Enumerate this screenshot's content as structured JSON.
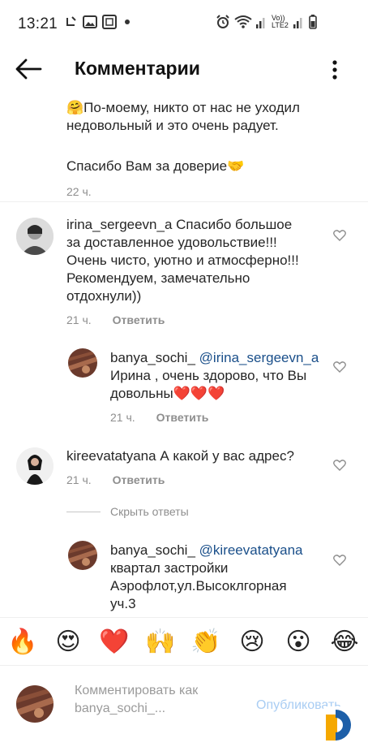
{
  "status_bar": {
    "time": "13:21",
    "network_label": "Vo)) LTE2"
  },
  "header": {
    "title": "Комментарии"
  },
  "comments": [
    {
      "lines": [
        "🤗По-моему, никто от нас не уходил",
        "недовольный и это очень радует.",
        "",
        "Спасибо Вам за доверие🤝"
      ],
      "time": "22 ч."
    },
    {
      "username": "irina_sergeevn_a",
      "first_line": "Спасибо большое",
      "lines": [
        "за доставленное удовольствие!!!",
        "Очень чисто, уютно  и атмосферно!!!",
        "Рекомендуем, замечательно",
        "отдохнули))"
      ],
      "time": "21 ч.",
      "reply_label": "Ответить"
    },
    {
      "username": "banya_sochi_",
      "mention": "@irina_sergeevn_a",
      "lines": [
        "Ирина , очень здорово, что Вы",
        "довольны❤️❤️❤️"
      ],
      "time": "21 ч.",
      "reply_label": "Ответить"
    },
    {
      "username": "kireevatatyana",
      "first_line": "А какой у вас адрес?",
      "time": "21 ч.",
      "reply_label": "Ответить"
    },
    {
      "username": "banya_sochi_",
      "mention": "@kireevatatyana",
      "lines": [
        "квартал застройки",
        "Аэрофлот,ул.Высоклгорная",
        "уч.3"
      ]
    }
  ],
  "hide_replies_label": "Скрыть ответы",
  "emoji_bar": [
    "🔥",
    "😍",
    "❤️",
    "🙌",
    "👏",
    "😢",
    "😮",
    "😂"
  ],
  "composer": {
    "placeholder_line1": "Комментировать как",
    "placeholder_line2": "banya_sochi_...",
    "publish_label": "Опубликовать"
  },
  "colors": {
    "mention": "#1a4f8a",
    "meta": "#8e8e8e",
    "publish": "#a9cdf3",
    "brand_orange": "#f5a800",
    "brand_blue": "#1d5fa8"
  }
}
